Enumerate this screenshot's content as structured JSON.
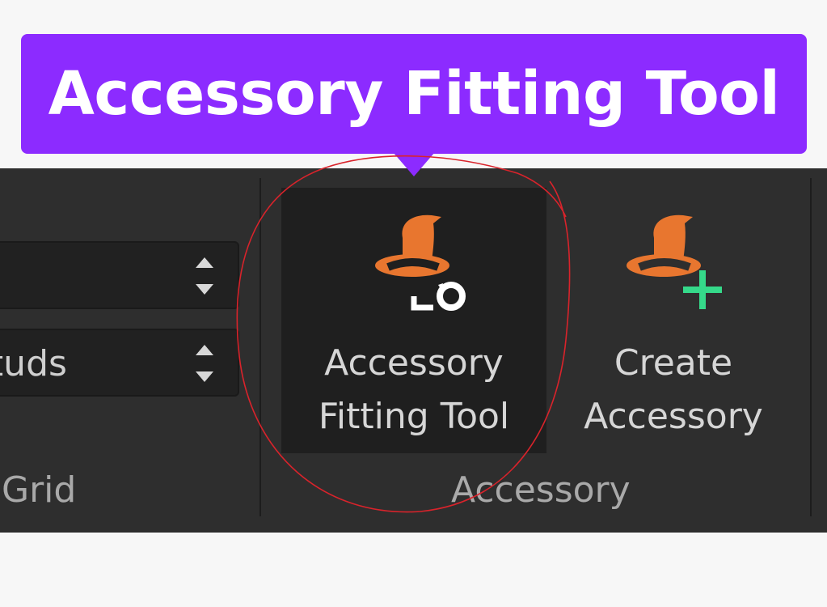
{
  "tooltip": {
    "text": "Accessory Fitting Tool"
  },
  "grid_group": {
    "spin_top_value": "",
    "spin_bottom_value": "studs",
    "label": "Grid"
  },
  "accessory_group": {
    "label": "Accessory",
    "buttons": [
      {
        "line1": "Accessory",
        "line2": "Fitting Tool",
        "icon": "witch-hat-fitting-icon",
        "selected": true
      },
      {
        "line1": "Create",
        "line2": "Accessory",
        "icon": "witch-hat-plus-icon",
        "selected": false
      }
    ]
  },
  "colors": {
    "tooltip_bg": "#8c2bff",
    "ribbon_bg": "#2e2e2e",
    "hat_orange": "#e8762f",
    "plus_green": "#35d98a",
    "annotation_red": "#d9232b"
  }
}
